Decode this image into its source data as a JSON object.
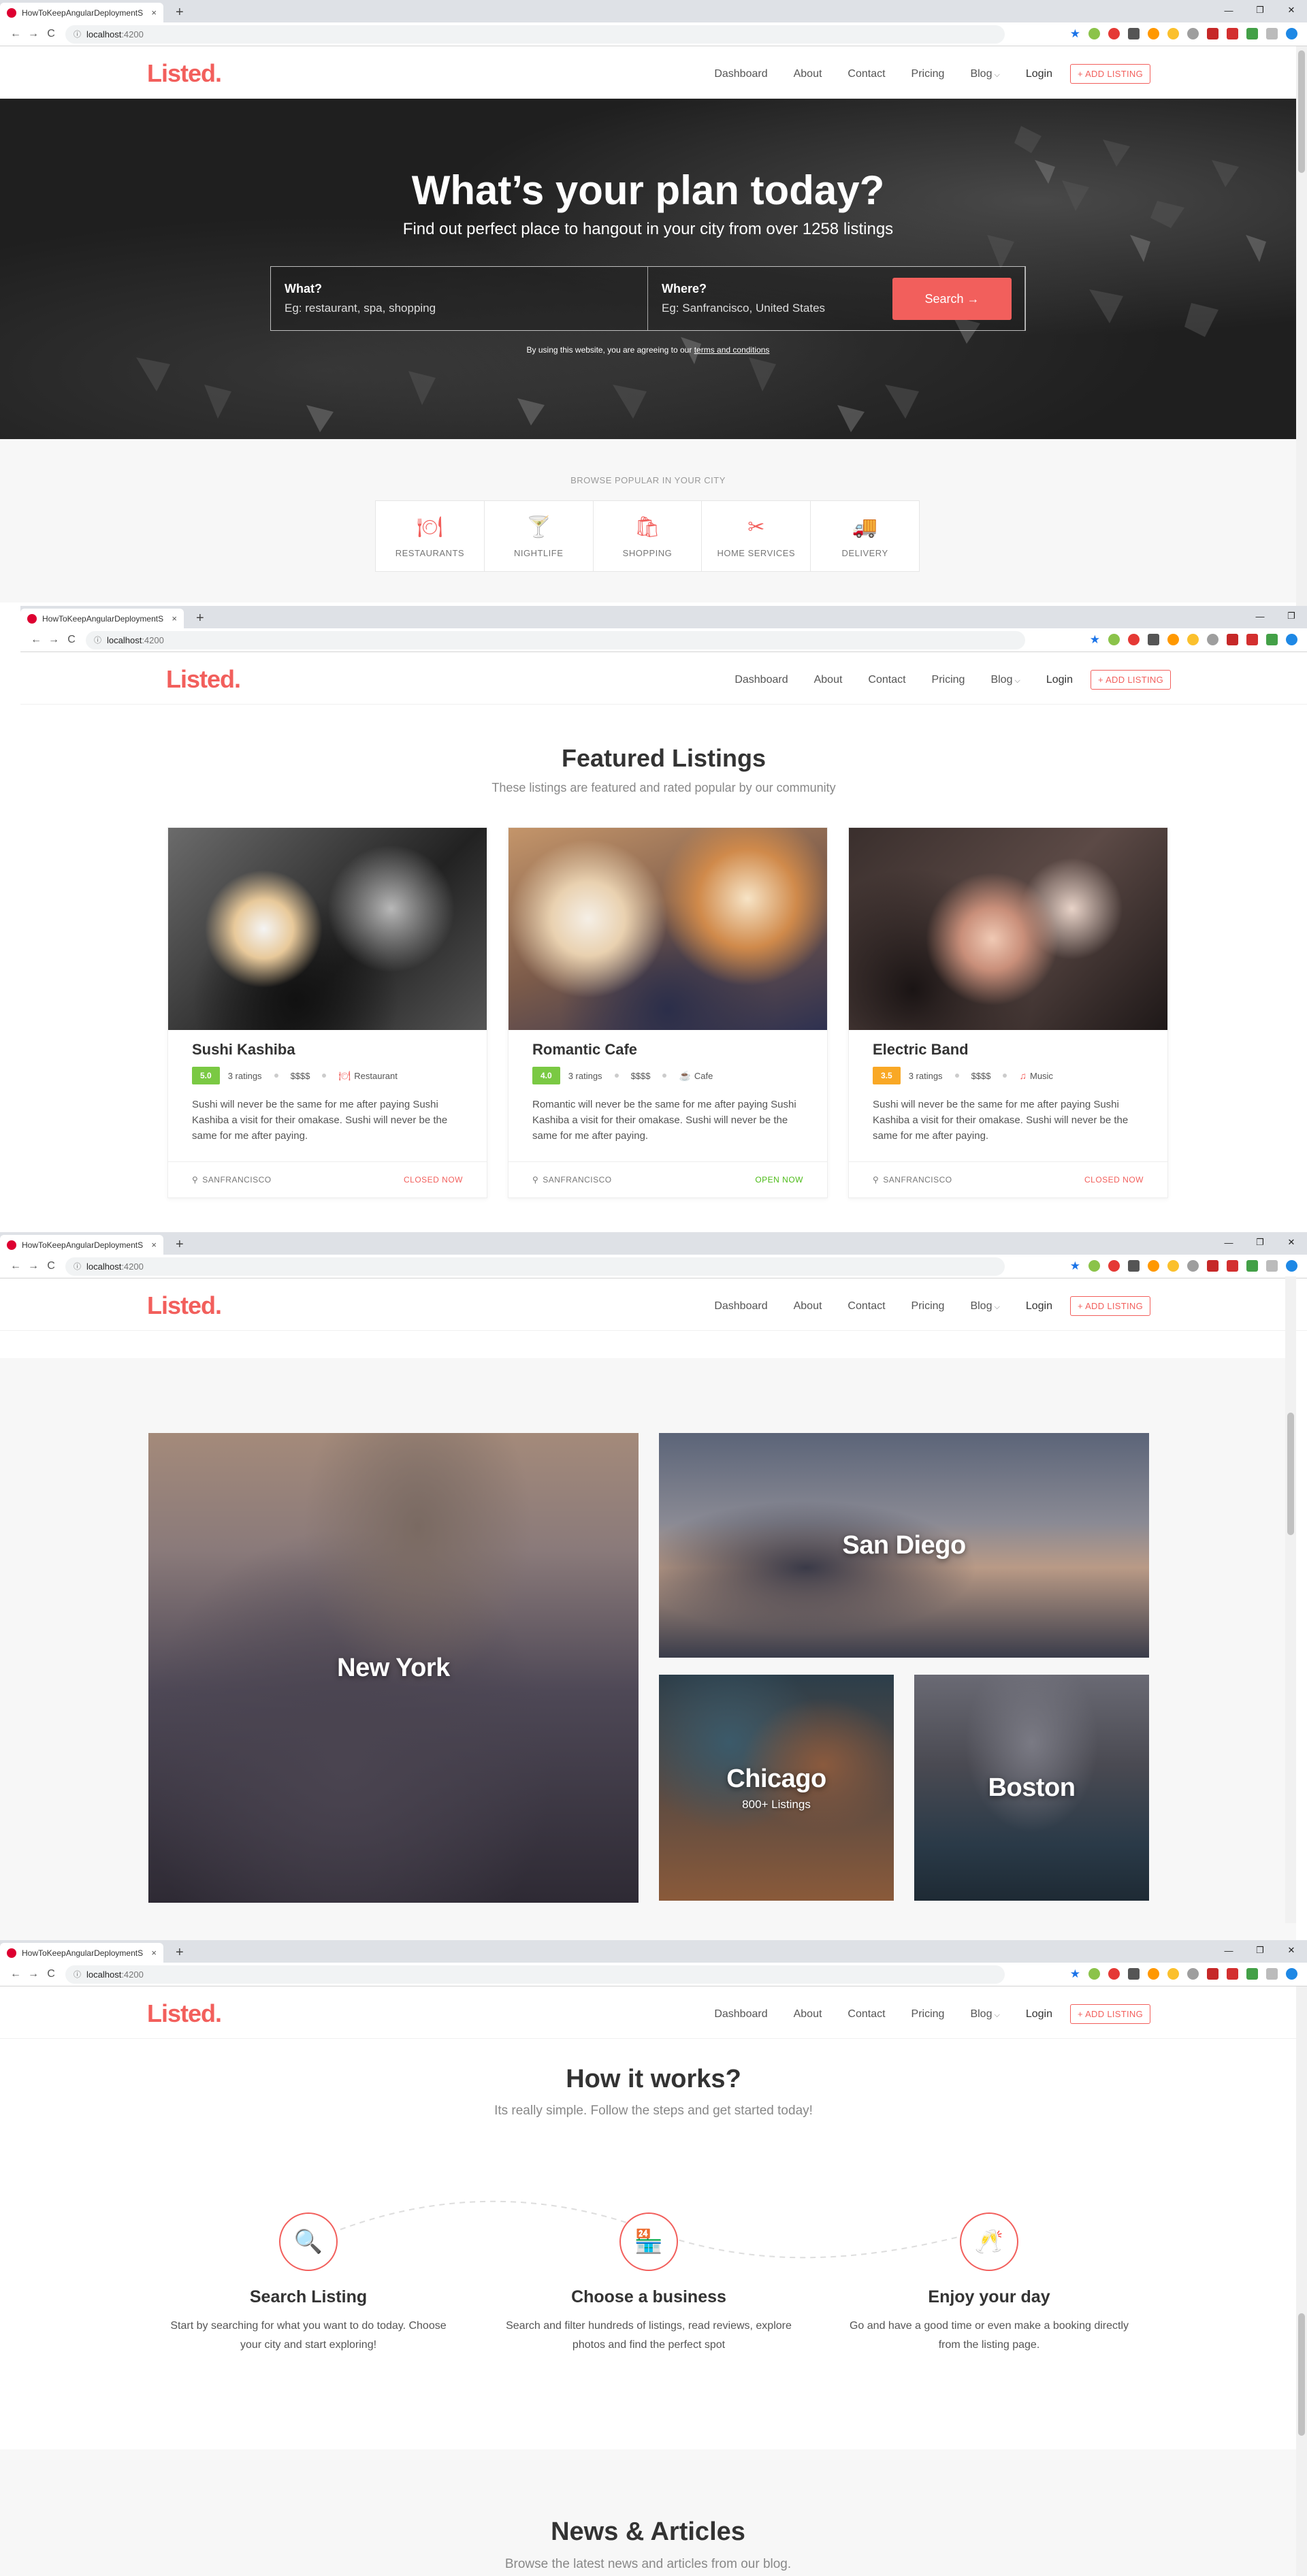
{
  "browser": {
    "tab_title": "HowToKeepAngularDeploymentS",
    "tab_close": "×",
    "new_tab": "+",
    "url_host": "localhost",
    "url_port": ":4200",
    "lock_icon": "ⓘ",
    "back": "←",
    "forward": "→",
    "reload": "C",
    "star_icon": "★",
    "minimize": "—",
    "restore": "❐",
    "close": "✕"
  },
  "site": {
    "logo": "Listed.",
    "nav": [
      "Dashboard",
      "About",
      "Contact",
      "Pricing",
      "Blog"
    ],
    "blog_caret": "⌵",
    "login": "Login",
    "add_listing": "+ ADD LISTING"
  },
  "hero": {
    "title": "What’s your plan today?",
    "subtitle": "Find out perfect place to hangout in your city from over 1258 listings",
    "what_label": "What?",
    "what_placeholder": "Eg: restaurant, spa, shopping",
    "where_label": "Where?",
    "where_placeholder": "Eg: Sanfrancisco, United States",
    "search_button": "Search →",
    "terms_prefix": "By using this website, you are agreeing to our",
    "terms_link": "terms and conditions"
  },
  "browse": {
    "title": "BROWSE POPULAR IN YOUR CITY",
    "categories": [
      {
        "label": "RESTAURANTS",
        "icon": "🍽"
      },
      {
        "label": "NIGHTLIFE",
        "icon": "🍸"
      },
      {
        "label": "SHOPPING",
        "icon": "🛍"
      },
      {
        "label": "HOME SERVICES",
        "icon": "✂"
      },
      {
        "label": "DELIVERY",
        "icon": "🚚"
      }
    ]
  },
  "featured": {
    "title": "Featured Listings",
    "subtitle": "These listings are featured and rated popular by our community",
    "cards": [
      {
        "name": "Sushi Kashiba",
        "rating": "5.0",
        "rating_color": "#7ac943",
        "ratings": "3 ratings",
        "price": "$$$$",
        "category": "Restaurant",
        "category_icon": "🍽",
        "text": "Sushi will never be the same for me after paying Sushi Kashiba a visit for their omakase. Sushi will never be the same for me after paying.",
        "location": "SANFRANCISCO",
        "status": "CLOSED NOW",
        "status_color": "#f25f5c"
      },
      {
        "name": "Romantic Cafe",
        "rating": "4.0",
        "rating_color": "#7ac943",
        "ratings": "3 ratings",
        "price": "$$$$",
        "category": "Cafe",
        "category_icon": "☕",
        "text": "Romantic will never be the same for me after paying Sushi Kashiba a visit for their omakase. Sushi will never be the same for me after paying.",
        "location": "SANFRANCISCO",
        "status": "OPEN NOW",
        "status_color": "#4cbb17"
      },
      {
        "name": "Electric Band",
        "rating": "3.5",
        "rating_color": "#f9a825",
        "ratings": "3 ratings",
        "price": "$$$$",
        "category": "Music",
        "category_icon": "♫",
        "text": "Sushi will never be the same for me after paying Sushi Kashiba a visit for their omakase. Sushi will never be the same for me after paying.",
        "location": "SANFRANCISCO",
        "status": "CLOSED NOW",
        "status_color": "#f25f5c"
      }
    ]
  },
  "cities": {
    "new_york": "New York",
    "san_diego": "San Diego",
    "chicago": "Chicago",
    "chicago_count": "800+ Listings",
    "boston": "Boston"
  },
  "how": {
    "title": "How it works?",
    "subtitle": "Its really simple. Follow the steps and get started today!",
    "steps": [
      {
        "title": "Search Listing",
        "text": "Start by searching for what you want to do today. Choose your city and start exploring!",
        "icon": "🔍"
      },
      {
        "title": "Choose a business",
        "text": "Search and filter hundreds of listings, read reviews, explore photos and find the perfect spot",
        "icon": "🏪"
      },
      {
        "title": "Enjoy your day",
        "text": "Go and have a good time or even make a booking directly from the listing page.",
        "icon": "🥂"
      }
    ]
  },
  "news": {
    "title": "News & Articles",
    "subtitle": "Browse the latest news and articles from our blog."
  },
  "colors": {
    "accent": "#f25f5c",
    "open": "#4cbb17"
  }
}
